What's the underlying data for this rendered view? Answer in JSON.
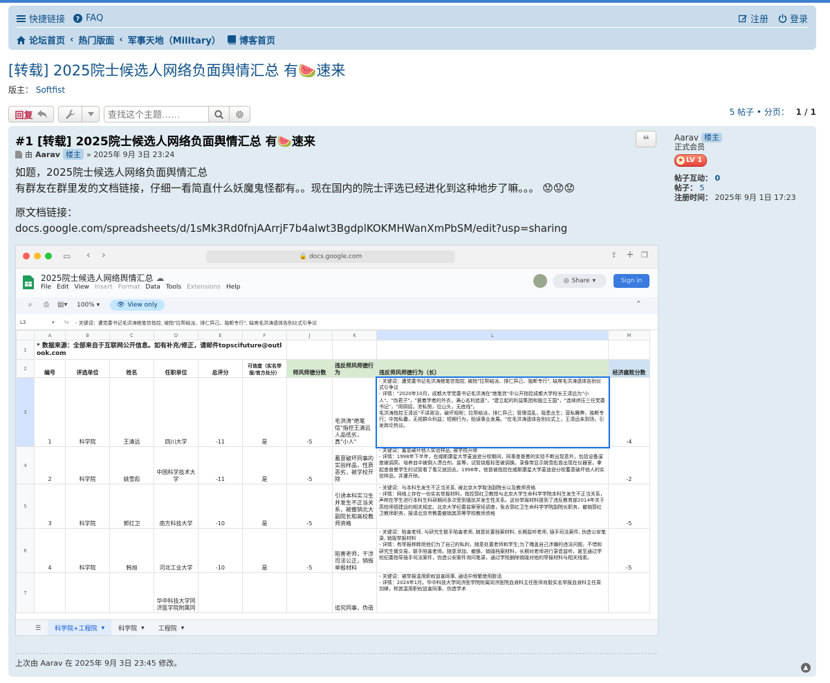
{
  "nav": {
    "quicklinks": "快捷链接",
    "faq": "FAQ",
    "register": "注册",
    "login": "登录",
    "breadcrumb": [
      "论坛首页",
      "热门版面",
      "军事天地（Military）",
      "博客首页"
    ]
  },
  "topic": {
    "title": "[转载] 2025院士候选人网络负面舆情汇总 有🍉速来",
    "moderator_label": "版主：",
    "moderator": "Softfist"
  },
  "toolbar": {
    "reply_label": "回复",
    "search_placeholder": "查找这个主题……",
    "pagination": "5 帖子 • 分页：",
    "page": "1 / 1"
  },
  "post": {
    "title": "#1 [转载] 2025院士候选人网络负面舆情汇总 有🍉速来",
    "by": "由",
    "author": "Aarav",
    "author_badge": "楼主",
    "date": "» 2025年 9月 3日 23:24",
    "line1": "如题，2025院士候选人网络负面舆情汇总",
    "line2": "有群友在群里发的文档链接，仔细一看简直什么妖魔鬼怪都有。。现在国内的院士评选已经进化到这种地步了嘛。。。 😟😟😟",
    "line3": "原文档链接：",
    "line4": "docs.google.com/spreadsheets/d/1sMk3Rd0fnjAArrjF7b4alwt3BgdplKOKMHWanXmPbSM/edit?usp=sharing",
    "edited": "上次由 Aarav 在 2025年 9月 3日 23:45 修改。"
  },
  "profile": {
    "name": "Aarav",
    "badge": "楼主",
    "rank": "正式会员",
    "level": "LV 1",
    "interactions_label": "帖子互动：",
    "interactions": "0",
    "posts_label": "帖子：",
    "posts": "5",
    "reg_label": "注册时间：",
    "reg": "2025年 9月 1日 17:23"
  },
  "screenshot": {
    "url": "docs.google.com",
    "doc_title": "2025院士候选人网络舆情汇总",
    "menu": [
      "File",
      "Edit",
      "View",
      "Insert",
      "Format",
      "Data",
      "Tools",
      "Extensions",
      "Help"
    ],
    "share": "Share",
    "signin": "Sign in",
    "zoom": "100%",
    "view_only": "View only",
    "cell_ref": "L3",
    "formula": "- 关键词：遭党委书记毛洪涛绝笔信指控, 被指\"拉帮结派、排仁异己、独断专行\", 缺席毛洪涛遗体告别仪式引争议",
    "columns": [
      "A",
      "B",
      "C",
      "D",
      "E",
      "F",
      "J",
      "K",
      "L",
      "M"
    ],
    "row1": "* 数据来源：全部来自于互联网公开信息。如有补充/修正，请邮件topscifuture@outlook.com",
    "headers": [
      "编号",
      "评选单位",
      "姓名",
      "任职单位",
      "总评分",
      "可信度（实名举报/官方处分）",
      "师风师德分数",
      "违反师风师德行为",
      "违反师风师德行为（长）",
      "经济腐败分数"
    ],
    "rows": [
      {
        "rn": "3",
        "no": "1",
        "unit": "科学院",
        "name": "王清远",
        "org": "四川大学",
        "score": "-11",
        "cred": "是",
        "ethics": "-5",
        "short": "毛洪涛\"绝笔信\"指控王清远人品低劣，真\"小人\"",
        "long": "- 关键词：遭党委书记毛洪涛绝笔信指控, 被指\"拉帮结派、排仁异己、独断专行\", 缺席毛洪涛遗体告别仪式引争议\n- 详情：\"2020年10月，成都大学党委书记毛洪涛在\"绝笔信\"中公开指控成都大学校长王清远为\"小人\"、\"伪君子\"，\"披着学者的外衣，满心名利追逐\"，\"建立起的利益集团和独立王国\"，\"连续挤压三任党委书记\"，\"用阴招，泄私愤，拉山头，无底线\"。\n毛洪涛指控王清远\"不讲政治，破坏规矩；拉帮结派，排仁异己；管理混乱，隐患丛生；营私舞弊，独断专行；中饱私囊，无视群众利益；短期行为，贻误事业发展。\"在毛洪涛遗体告别仪式上，王清远未到场，引发舆论热议。",
        "econ": "-4"
      },
      {
        "rn": "4",
        "no": "2",
        "unit": "科学院",
        "name": "姚雪彪",
        "org": "中国科学技术大学",
        "score": "-11",
        "cred": "是",
        "ethics": "-5",
        "short": "蓄意破坏同事的实验样品，性质恶劣，被学校开除",
        "long": "- 关键词：蓄意破坏他人实验样品, 被学校开除\n- 详情：1998年下半年，在威斯康星大学麦迪逊分校期间，同事查普曼的实验不断出现意外，包括设备温度被调高、培养皿中被倒入漂白剂、盐等，试管烧瓶标签被调换。录像带显示姚雪彪曾出现在仪器室，拿起查普曼学生的试管看了看又放回去。1998年，他曾被指控在威斯康星大学麦迪逊分校蓄意破坏他人的实验样品，并遭开除。",
        "econ": "-2"
      },
      {
        "rn": "5",
        "no": "3",
        "unit": "科学院",
        "name": "郭红卫",
        "org": "南方科技大学",
        "score": "-10",
        "cred": "是",
        "ethics": "-5",
        "short": "引诱本科实习生并发生不正当关系，被撤销北大副院长和高校教师资格",
        "long": "- 关键词：与本科生发生不正当关系, 被北京大学取消副院长以及教师资格\n- 详情：网络上存在一份实名举报材料，指控郭红卫教授与北京大学生命科学学院本科生发生不正当关系，声称在学生进行本科生科研期间多次受到骚扰并发生性关系。这份举报材料提到了违反教育部2014年关于高校师德建设的相关规定。北京大学纪委监察室经调查，免去郭红卫生命科学学院副院长职务，撤销郭红卫教师职务，报请北京市教委撤销其高等学校教师资格",
        "econ": "-5"
      },
      {
        "rn": "6",
        "no": "4",
        "unit": "科学院",
        "name": "韩旭",
        "org": "河北工业大学",
        "score": "-10",
        "cred": "是",
        "ethics": "-5",
        "short": "陷害老师，干涉司法公正，销毁举报材料",
        "long": "- 关键词：陷害老师, 与研究生联手陷害老师, 随意处置档案材料, 长期监听老师, 插手司法案件, 伪造公安笔录, 销毁举报材料\n- 详情：有举报称韩旭他们为了自己的私利，随意处置老师和学生;为了掩盖自己涉嫌的违法问题，不惜和研究生做交易，联手陷害老师。随意添加、撤换、销毁档案材料，长期对老师进行录音监听，甚至通过学校纪委指导插手司法案件，伪造公安案件询问笔录，通过学校删除销毁对他的举报材料与相关线索。",
        "econ": "-5"
      },
      {
        "rn": "7",
        "no": "",
        "unit": "",
        "name": "",
        "org": "华中科技大学同济医学院附属同",
        "score": "",
        "cred": "",
        "ethics": "",
        "short": "追究同事，伪造",
        "long": "- 关键词：被举报滥用职权迫害同事, 通话中频繁使用脏话\n- 详情：2024年1月，华中科技大学同济医学院附属同济医院血液科主任医师肖毅实名举报血液科主任周剑峰，称其滥用职权迫害同事、伪造学术",
        "econ": ""
      }
    ],
    "sheet_tabs": [
      "科学院+工程院",
      "科学院",
      "工程院"
    ]
  }
}
